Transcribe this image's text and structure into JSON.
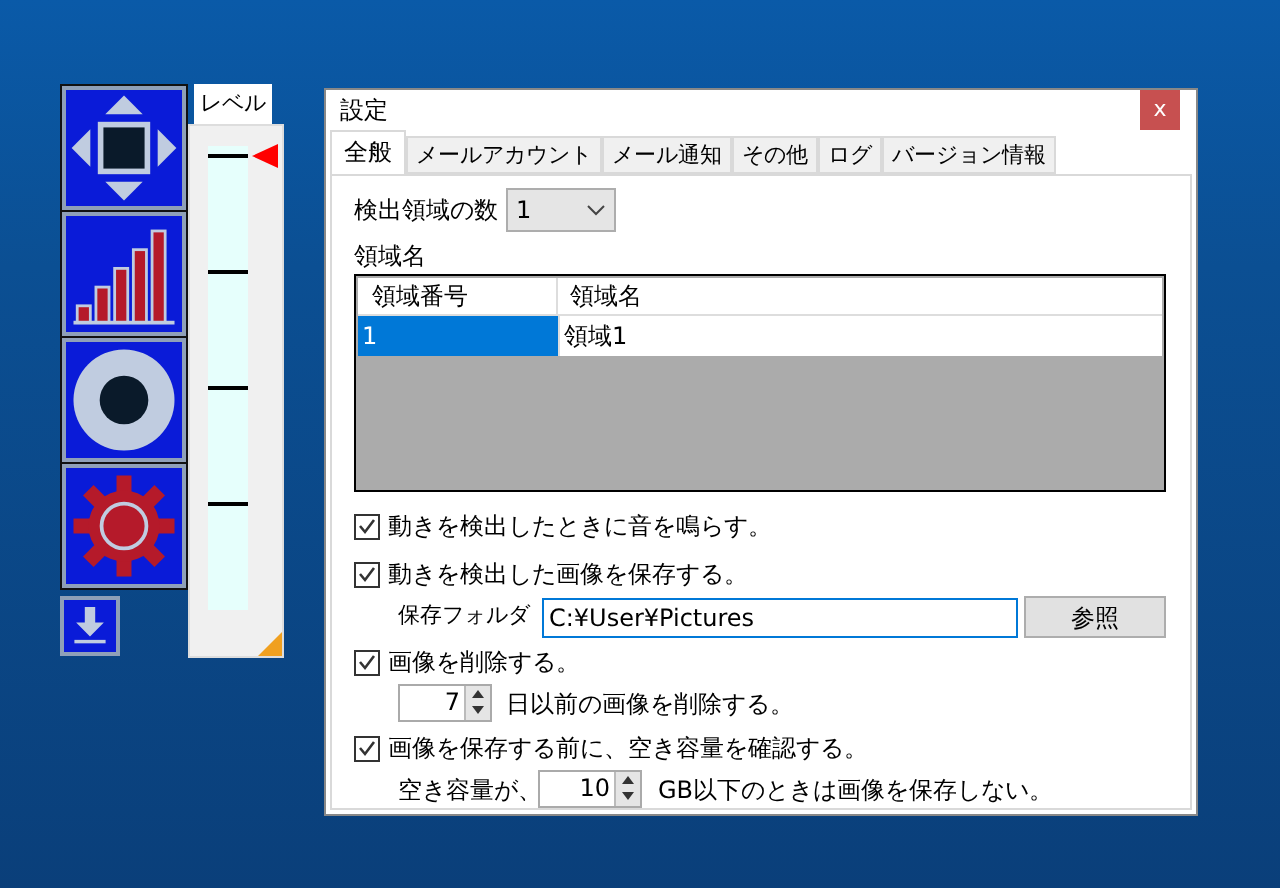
{
  "level_panel": {
    "tab": "レベル",
    "level": 1
  },
  "dialog": {
    "title": "設定",
    "close": "x",
    "tabs": [
      {
        "label": "全般",
        "selected": true
      },
      {
        "label": "メールアカウント",
        "selected": false
      },
      {
        "label": "メール通知",
        "selected": false
      },
      {
        "label": "その他",
        "selected": false
      },
      {
        "label": "ログ",
        "selected": false
      },
      {
        "label": "バージョン情報",
        "selected": false
      }
    ],
    "area_count": {
      "label": "検出領域の数",
      "value": "1"
    },
    "area_names": {
      "label": "領域名",
      "columns": [
        "領域番号",
        "領域名"
      ],
      "rows": [
        {
          "cells": [
            "1",
            "領域1"
          ],
          "selected": true
        }
      ]
    },
    "sound_option": {
      "label": "動きを検出したときに音を鳴らす。",
      "checked": true
    },
    "save_option": {
      "label": "動きを検出した画像を保存する。",
      "checked": true
    },
    "save_folder": {
      "label": "保存フォルダ",
      "value": "C:¥User¥Pictures",
      "button": "参照"
    },
    "delete_option": {
      "label": "画像を削除する。",
      "checked": true
    },
    "delete_days": {
      "value": "7",
      "suffix": "日以前の画像を削除する。"
    },
    "space_option": {
      "label": "画像を保存する前に、空き容量を確認する。",
      "checked": true
    },
    "space_limit": {
      "prefix": "空き容量が、",
      "value": "10",
      "suffix": "GB以下のときは画像を保存しない。"
    }
  }
}
